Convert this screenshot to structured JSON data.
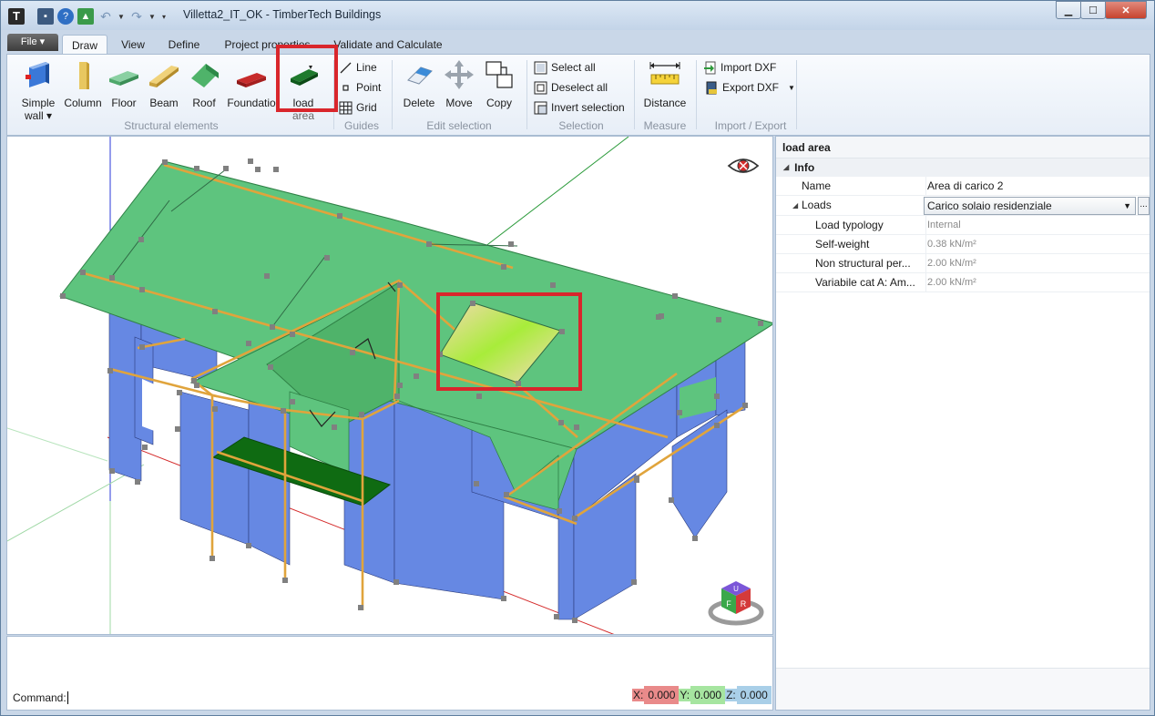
{
  "window": {
    "title": "Villetta2_IT_OK - TimberTech Buildings",
    "app_icon_letter": "T"
  },
  "file_menu": {
    "label": "File ▾"
  },
  "tabs": [
    "Draw",
    "View",
    "Define",
    "Project properties",
    "Validate and Calculate"
  ],
  "active_tab": "Draw",
  "ribbon": {
    "structural": {
      "simple_wall_1": "Simple",
      "simple_wall_2": "wall ▾",
      "column": "Column",
      "floor": "Floor",
      "beam": "Beam",
      "roof": "Roof",
      "foundation": "Foundatio",
      "load_area_1": "load",
      "load_area_2": "area",
      "group_label": "Structural elements"
    },
    "guides": {
      "line": "Line",
      "point": "Point",
      "grid": "Grid",
      "group_label": "Guides"
    },
    "edit": {
      "delete": "Delete",
      "move": "Move",
      "copy": "Copy",
      "group_label": "Edit selection"
    },
    "selection": {
      "select_all": "Select all",
      "deselect_all": "Deselect all",
      "invert": "Invert selection",
      "group_label": "Selection"
    },
    "measure": {
      "distance": "Distance",
      "group_label": "Measure"
    },
    "import_export": {
      "import_dxf": "Import DXF",
      "export_dxf": "Export DXF",
      "group_label": "Import / Export"
    }
  },
  "properties": {
    "title": "load area",
    "category": "Info",
    "name_label": "Name",
    "name_value": "Area di carico 2",
    "loads_label": "Loads",
    "loads_value": "Carico solaio residenziale",
    "ellipsis": "...",
    "rows": [
      {
        "label": "Load typology",
        "value": "Internal"
      },
      {
        "label": "Self-weight",
        "value": "0.38 kN/m²"
      },
      {
        "label": "Non structural per...",
        "value": "2.00 kN/m²"
      },
      {
        "label": "Variabile cat A: Am...",
        "value": "2.00 kN/m²"
      }
    ]
  },
  "viewcube": {
    "u": "U",
    "f": "F",
    "r": "R"
  },
  "command": {
    "label": "Command:",
    "x_label": "X:",
    "x_value": "0.000",
    "y_label": "Y:",
    "y_value": "0.000",
    "z_label": "Z:",
    "z_value": "0.000"
  },
  "colors": {
    "roof": "#5ec47e",
    "wall": "#6688e3",
    "beam": "#e0a43c",
    "highlight": "#d9262c",
    "balcony": "#0f6b12"
  }
}
